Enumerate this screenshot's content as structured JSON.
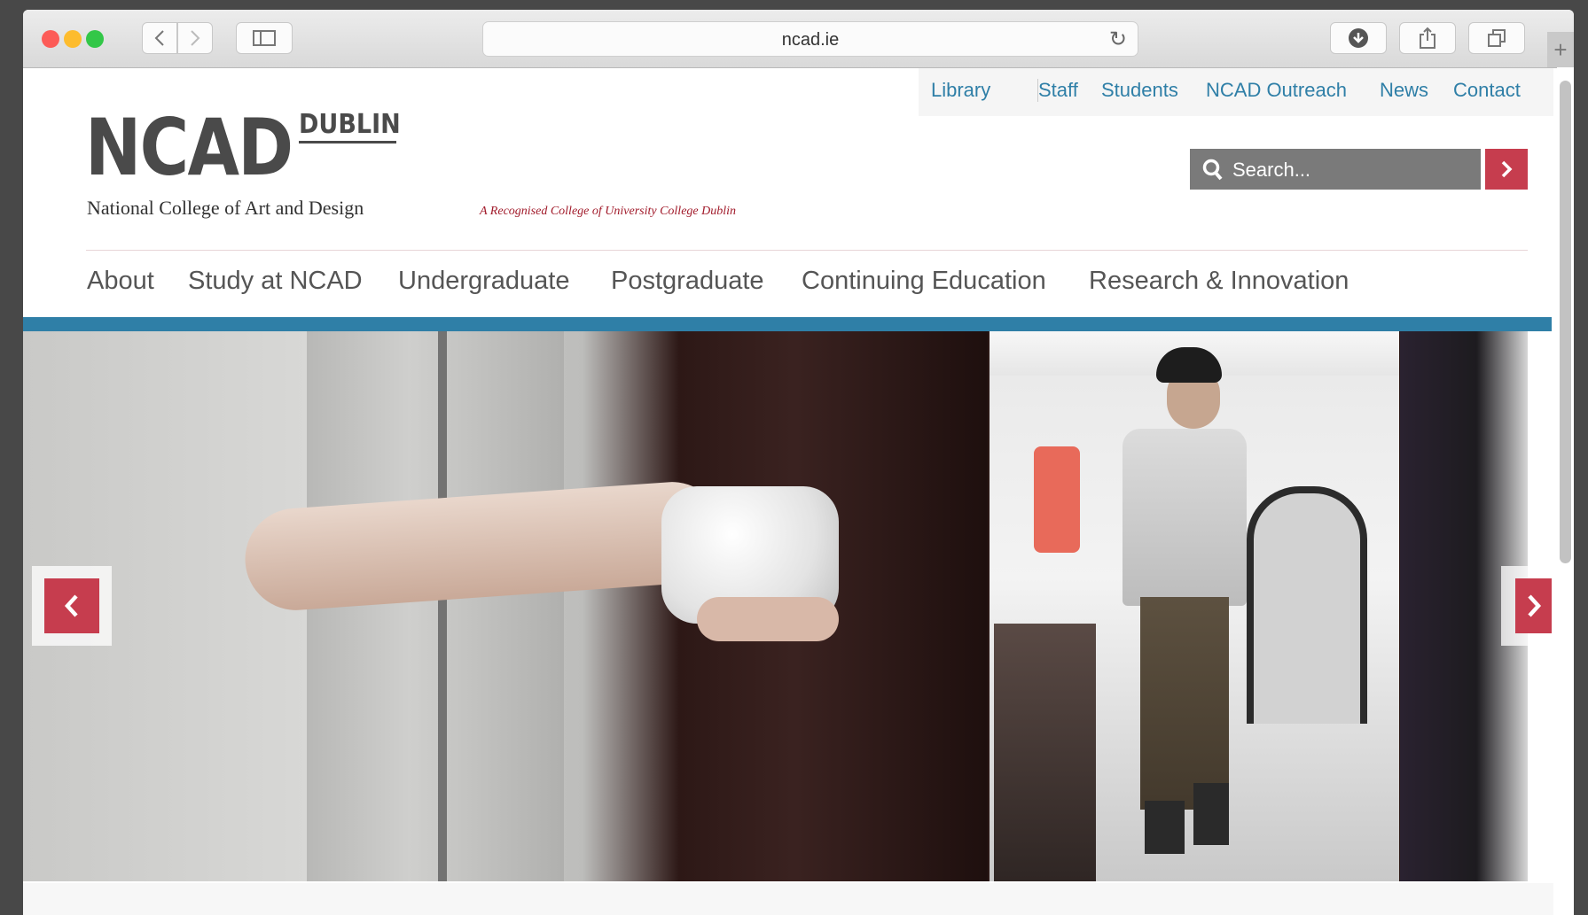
{
  "browser": {
    "url": "ncad.ie",
    "traffic_colors": {
      "close": "#fc5b57",
      "minimize": "#fdbc2e",
      "maximize": "#33c748"
    },
    "icons": [
      "back-icon",
      "forward-icon",
      "sidebar-icon",
      "reload-icon",
      "download-icon",
      "share-icon",
      "tabs-icon",
      "new-tab-icon"
    ]
  },
  "util_nav": [
    "Library",
    "Staff",
    "Students",
    "NCAD Outreach",
    "News",
    "Contact"
  ],
  "logo": {
    "main": "NCAD",
    "dublin": "DUBLIN",
    "subtitle": "National College of Art and Design",
    "ucd": "A Recognised College of University College Dublin"
  },
  "search": {
    "placeholder": "Search..."
  },
  "main_nav": [
    "About",
    "Study at NCAD",
    "Undergraduate",
    "Postgraduate",
    "Continuing Education",
    "Research & Innovation"
  ],
  "colors": {
    "accent_blue": "#2f7fa7",
    "accent_red": "#c63d4e"
  }
}
